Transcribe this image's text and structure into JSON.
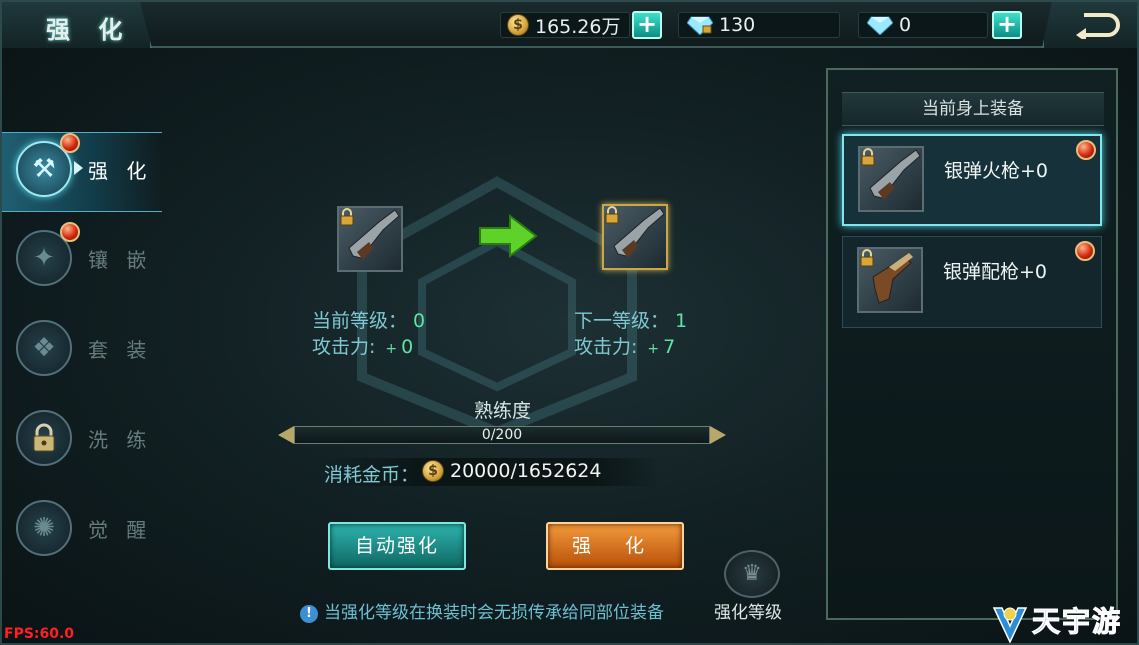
{
  "header": {
    "title": "强 化",
    "gold": "165.26万",
    "bound_diamonds": "130",
    "diamonds": "0",
    "coin_icon": "coin-icon",
    "bound_diamond_icon": "locked-diamond-icon",
    "diamond_icon": "diamond-icon",
    "back_icon": "return-arrow-icon"
  },
  "menu": {
    "items": [
      {
        "label": "强 化",
        "icon": "hammer-icon",
        "active": true,
        "badge": true
      },
      {
        "label": "镶 嵌",
        "icon": "gem-socket-icon",
        "active": false,
        "badge": true
      },
      {
        "label": "套 装",
        "icon": "armor-set-icon",
        "active": false,
        "badge": false
      },
      {
        "label": "洗 练",
        "icon": "lock-icon",
        "active": false,
        "badge": false
      },
      {
        "label": "觉 醒",
        "icon": "awaken-icon",
        "active": false,
        "badge": false
      }
    ]
  },
  "enhance": {
    "current_level_label": "当前等级：",
    "current_level": "0",
    "current_attack_label": "攻击力:",
    "current_attack_plus": "+",
    "current_attack": "0",
    "next_level_label": "下一等级：",
    "next_level": "1",
    "next_attack_label": "攻击力:",
    "next_attack_plus": "+",
    "next_attack": "7",
    "proficiency_label": "熟练度",
    "proficiency_text": "0/200",
    "proficiency_value": 0,
    "proficiency_max": 200,
    "cost_label": "消耗金币：",
    "cost_value": "20000/1652624",
    "auto_button": "自动强化",
    "enhance_button": "强 化",
    "level_button": "强化等级",
    "tip": "当强化等级在换装时会无损传承给同部位装备"
  },
  "panel": {
    "header": "当前身上装备",
    "items": [
      {
        "name": "银弹火枪+0",
        "selected": true,
        "badge": true
      },
      {
        "name": "银弹配枪+0",
        "selected": false,
        "badge": true
      }
    ]
  },
  "fps": "FPS:60.0",
  "watermark": "天宇游",
  "colors": {
    "accent": "#7fe6f0",
    "green_value": "#5fe3a0",
    "orange_button": "#e0741f",
    "teal_button": "#1f8f8a",
    "fps_red": "#ff2020"
  }
}
